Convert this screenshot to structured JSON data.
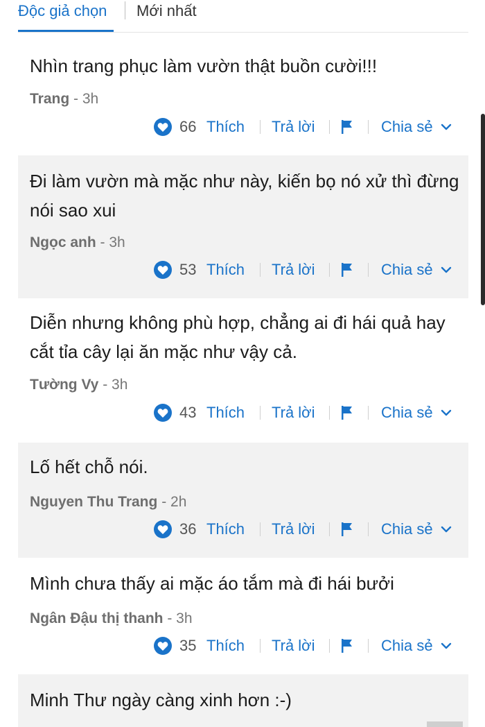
{
  "tabs": {
    "active": "Độc giả chọn",
    "inactive": "Mới nhất"
  },
  "actions": {
    "like_label": "Thích",
    "reply_label": "Trả lời",
    "share_label": "Chia sẻ"
  },
  "comments": [
    {
      "text": "Nhìn trang phục làm vườn thật buồn cười!!!",
      "author": "Trang",
      "time": "- 3h",
      "likes": "66"
    },
    {
      "text": "Đi làm vườn mà mặc như này, kiến bọ nó xử thì đừng nói sao xui",
      "author": "Ngọc anh",
      "time": "- 3h",
      "likes": "53"
    },
    {
      "text": "Diễn nhưng không phù hợp, chẳng ai đi hái quả hay cắt tỉa cây lại ăn mặc như vậy cả.",
      "author": "Tường Vy",
      "time": "- 3h",
      "likes": "43"
    },
    {
      "text": "Lố hết chỗ nói.",
      "author": "Nguyen Thu Trang",
      "time": "- 2h",
      "likes": "36"
    },
    {
      "text": "Mình chưa thấy ai mặc áo tắm mà đi hái bưởi",
      "author": "Ngân Đậu thị thanh",
      "time": "- 3h",
      "likes": "35"
    },
    {
      "text": "Minh Thư ngày càng xinh hơn :-)"
    }
  ],
  "colors": {
    "accent": "#1a73c9",
    "shaded_background": "#f2f2f2"
  },
  "icons": {
    "like": "heart-icon",
    "report": "flag-icon",
    "share_menu": "chevron-down-icon"
  }
}
